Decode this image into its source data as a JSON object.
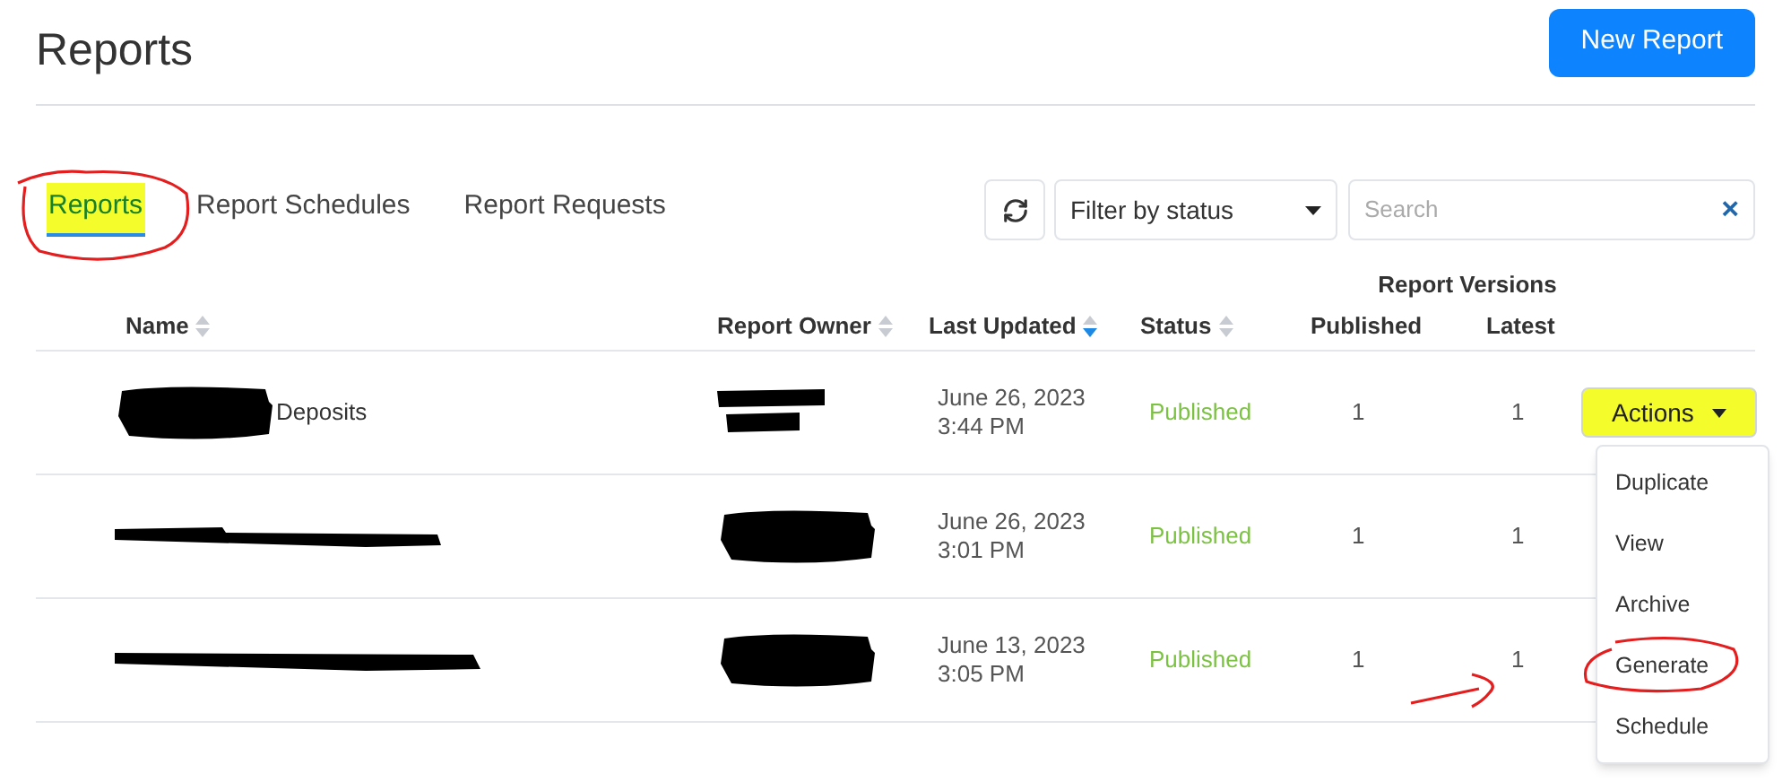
{
  "page": {
    "title": "Reports",
    "new_button": "New Report"
  },
  "tabs": [
    {
      "label": "Reports",
      "selected": true,
      "highlighted": true,
      "circled": true
    },
    {
      "label": "Report Schedules",
      "selected": false,
      "highlighted": false,
      "circled": false
    },
    {
      "label": "Report Requests",
      "selected": false,
      "highlighted": false,
      "circled": false
    }
  ],
  "toolbar": {
    "filter": "Filter by status",
    "search_placeholder": "Search",
    "clear": "×"
  },
  "table": {
    "group_header": "Report Versions",
    "columns": [
      {
        "label": "Name",
        "kind": "sortable"
      },
      {
        "label": "Report Owner",
        "kind": "sortable"
      },
      {
        "label": "Last Updated",
        "kind": "sorted"
      },
      {
        "label": "Status",
        "kind": "sortable"
      },
      {
        "label": "Published",
        "kind": "plain"
      },
      {
        "label": "Latest",
        "kind": "plain"
      }
    ],
    "rows": [
      {
        "name": "Deposits",
        "name_redaction": {
          "kind": "blob"
        },
        "owner_redaction": {
          "kind": "bars"
        },
        "date": "June 26, 2023",
        "time": "3:44 PM",
        "status": "Published",
        "published": "1",
        "latest": "1",
        "arrow_annotation": false
      },
      {
        "name_redaction": {
          "kind": "strike"
        },
        "owner_redaction": {
          "kind": "blob"
        },
        "date": "June 26, 2023",
        "time": "3:01 PM",
        "status": "Published",
        "published": "1",
        "latest": "1",
        "arrow_annotation": false
      },
      {
        "name_redaction": {
          "kind": "strike_long"
        },
        "owner_redaction": {
          "kind": "blob"
        },
        "date": "June 13, 2023",
        "time": "3:05 PM",
        "status": "Published",
        "published": "1",
        "latest": "1",
        "arrow_annotation": true
      }
    ]
  },
  "actions": {
    "label": "Actions",
    "highlighted": true,
    "expanded": true,
    "menu": [
      {
        "label": "Duplicate",
        "circled": false
      },
      {
        "label": "View",
        "circled": false
      },
      {
        "label": "Archive",
        "circled": false
      },
      {
        "label": "Generate",
        "circled": true
      },
      {
        "label": "Schedule",
        "circled": false
      }
    ]
  }
}
